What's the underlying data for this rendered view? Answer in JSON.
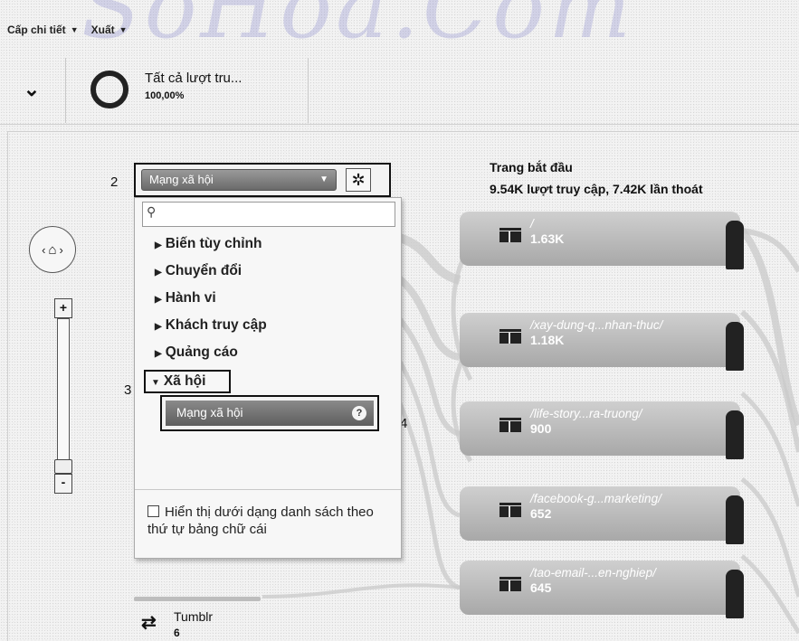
{
  "watermark": "SoHoa.Com",
  "toolbar": {
    "detail_level": "Cấp chi tiết",
    "export": "Xuất"
  },
  "segment": {
    "name": "Tất cả lượt tru...",
    "percent": "100,00%"
  },
  "steps": [
    "2",
    "3",
    "4"
  ],
  "dimension_selector": {
    "selected": "Mạng xã hội"
  },
  "dropdown": {
    "search_placeholder": "",
    "categories": [
      "Biến tùy chỉnh",
      "Chuyển đổi",
      "Hành vi",
      "Khách truy cập",
      "Quảng cáo"
    ],
    "expanded_category": "Xã hội",
    "highlighted_item": "Mạng xã hội",
    "alphabetical_option": "Hiển thị dưới dạng danh sách theo thứ tự bảng chữ cái",
    "alphabetical_checked": false
  },
  "source_node": {
    "name": "Tumblr",
    "count": "6"
  },
  "starting_pages": {
    "title": "Trang bắt đầu",
    "summary": "9.54K lượt truy cập, 7.42K lần thoát",
    "nodes": [
      {
        "path": "/",
        "count": "1.63K"
      },
      {
        "path": "/xay-dung-q...nhan-thuc/",
        "count": "1.18K"
      },
      {
        "path": "/life-story...ra-truong/",
        "count": "900"
      },
      {
        "path": "/facebook-g...marketing/",
        "count": "652"
      },
      {
        "path": "/tao-email-...en-nghiep/",
        "count": "645"
      }
    ]
  }
}
